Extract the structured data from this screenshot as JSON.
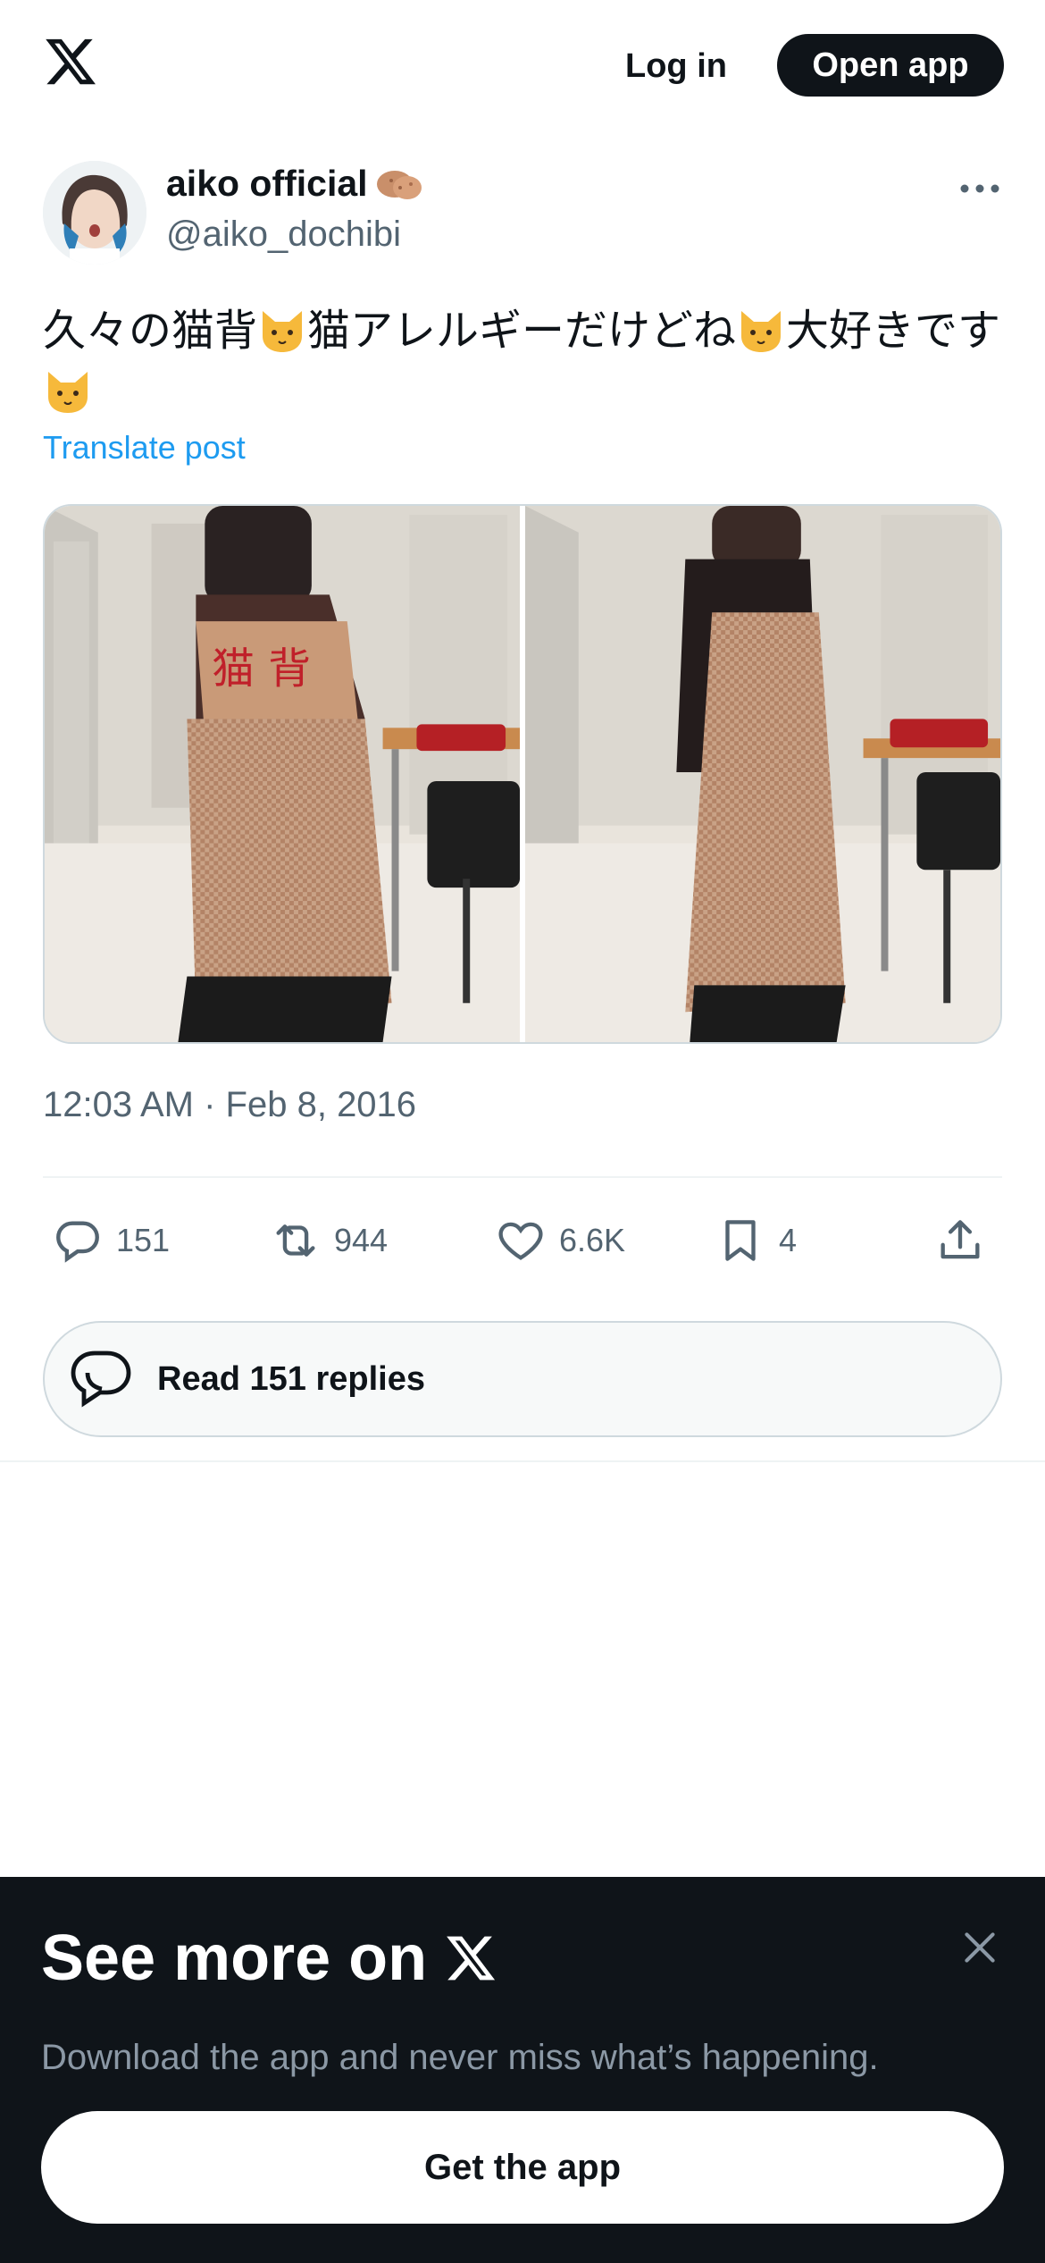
{
  "header": {
    "logo_icon": "x-logo-icon",
    "login_label": "Log in",
    "open_app_label": "Open app"
  },
  "post": {
    "author_name": "aiko official",
    "author_handle": "@aiko_dochibi",
    "text_segments": [
      "久々の猫背",
      "猫アレルギーだけどね",
      "大好きです"
    ],
    "translate_label": "Translate post",
    "timestamp": "12:03 AM · Feb 8, 2016",
    "photo_overlay_text": "猫 背",
    "stats": {
      "replies": "151",
      "reposts": "944",
      "likes": "6.6K",
      "bookmarks": "4"
    },
    "read_replies_label": "Read 151 replies"
  },
  "sheet": {
    "title": "See more on",
    "subtitle": "Download the app and never miss what’s happening.",
    "cta_label": "Get the app"
  },
  "colors": {
    "text_primary": "#0f1419",
    "text_secondary": "#536471",
    "link": "#1d9bf0",
    "sheet_bg": "#0f1419",
    "border": "#cfd9de"
  }
}
